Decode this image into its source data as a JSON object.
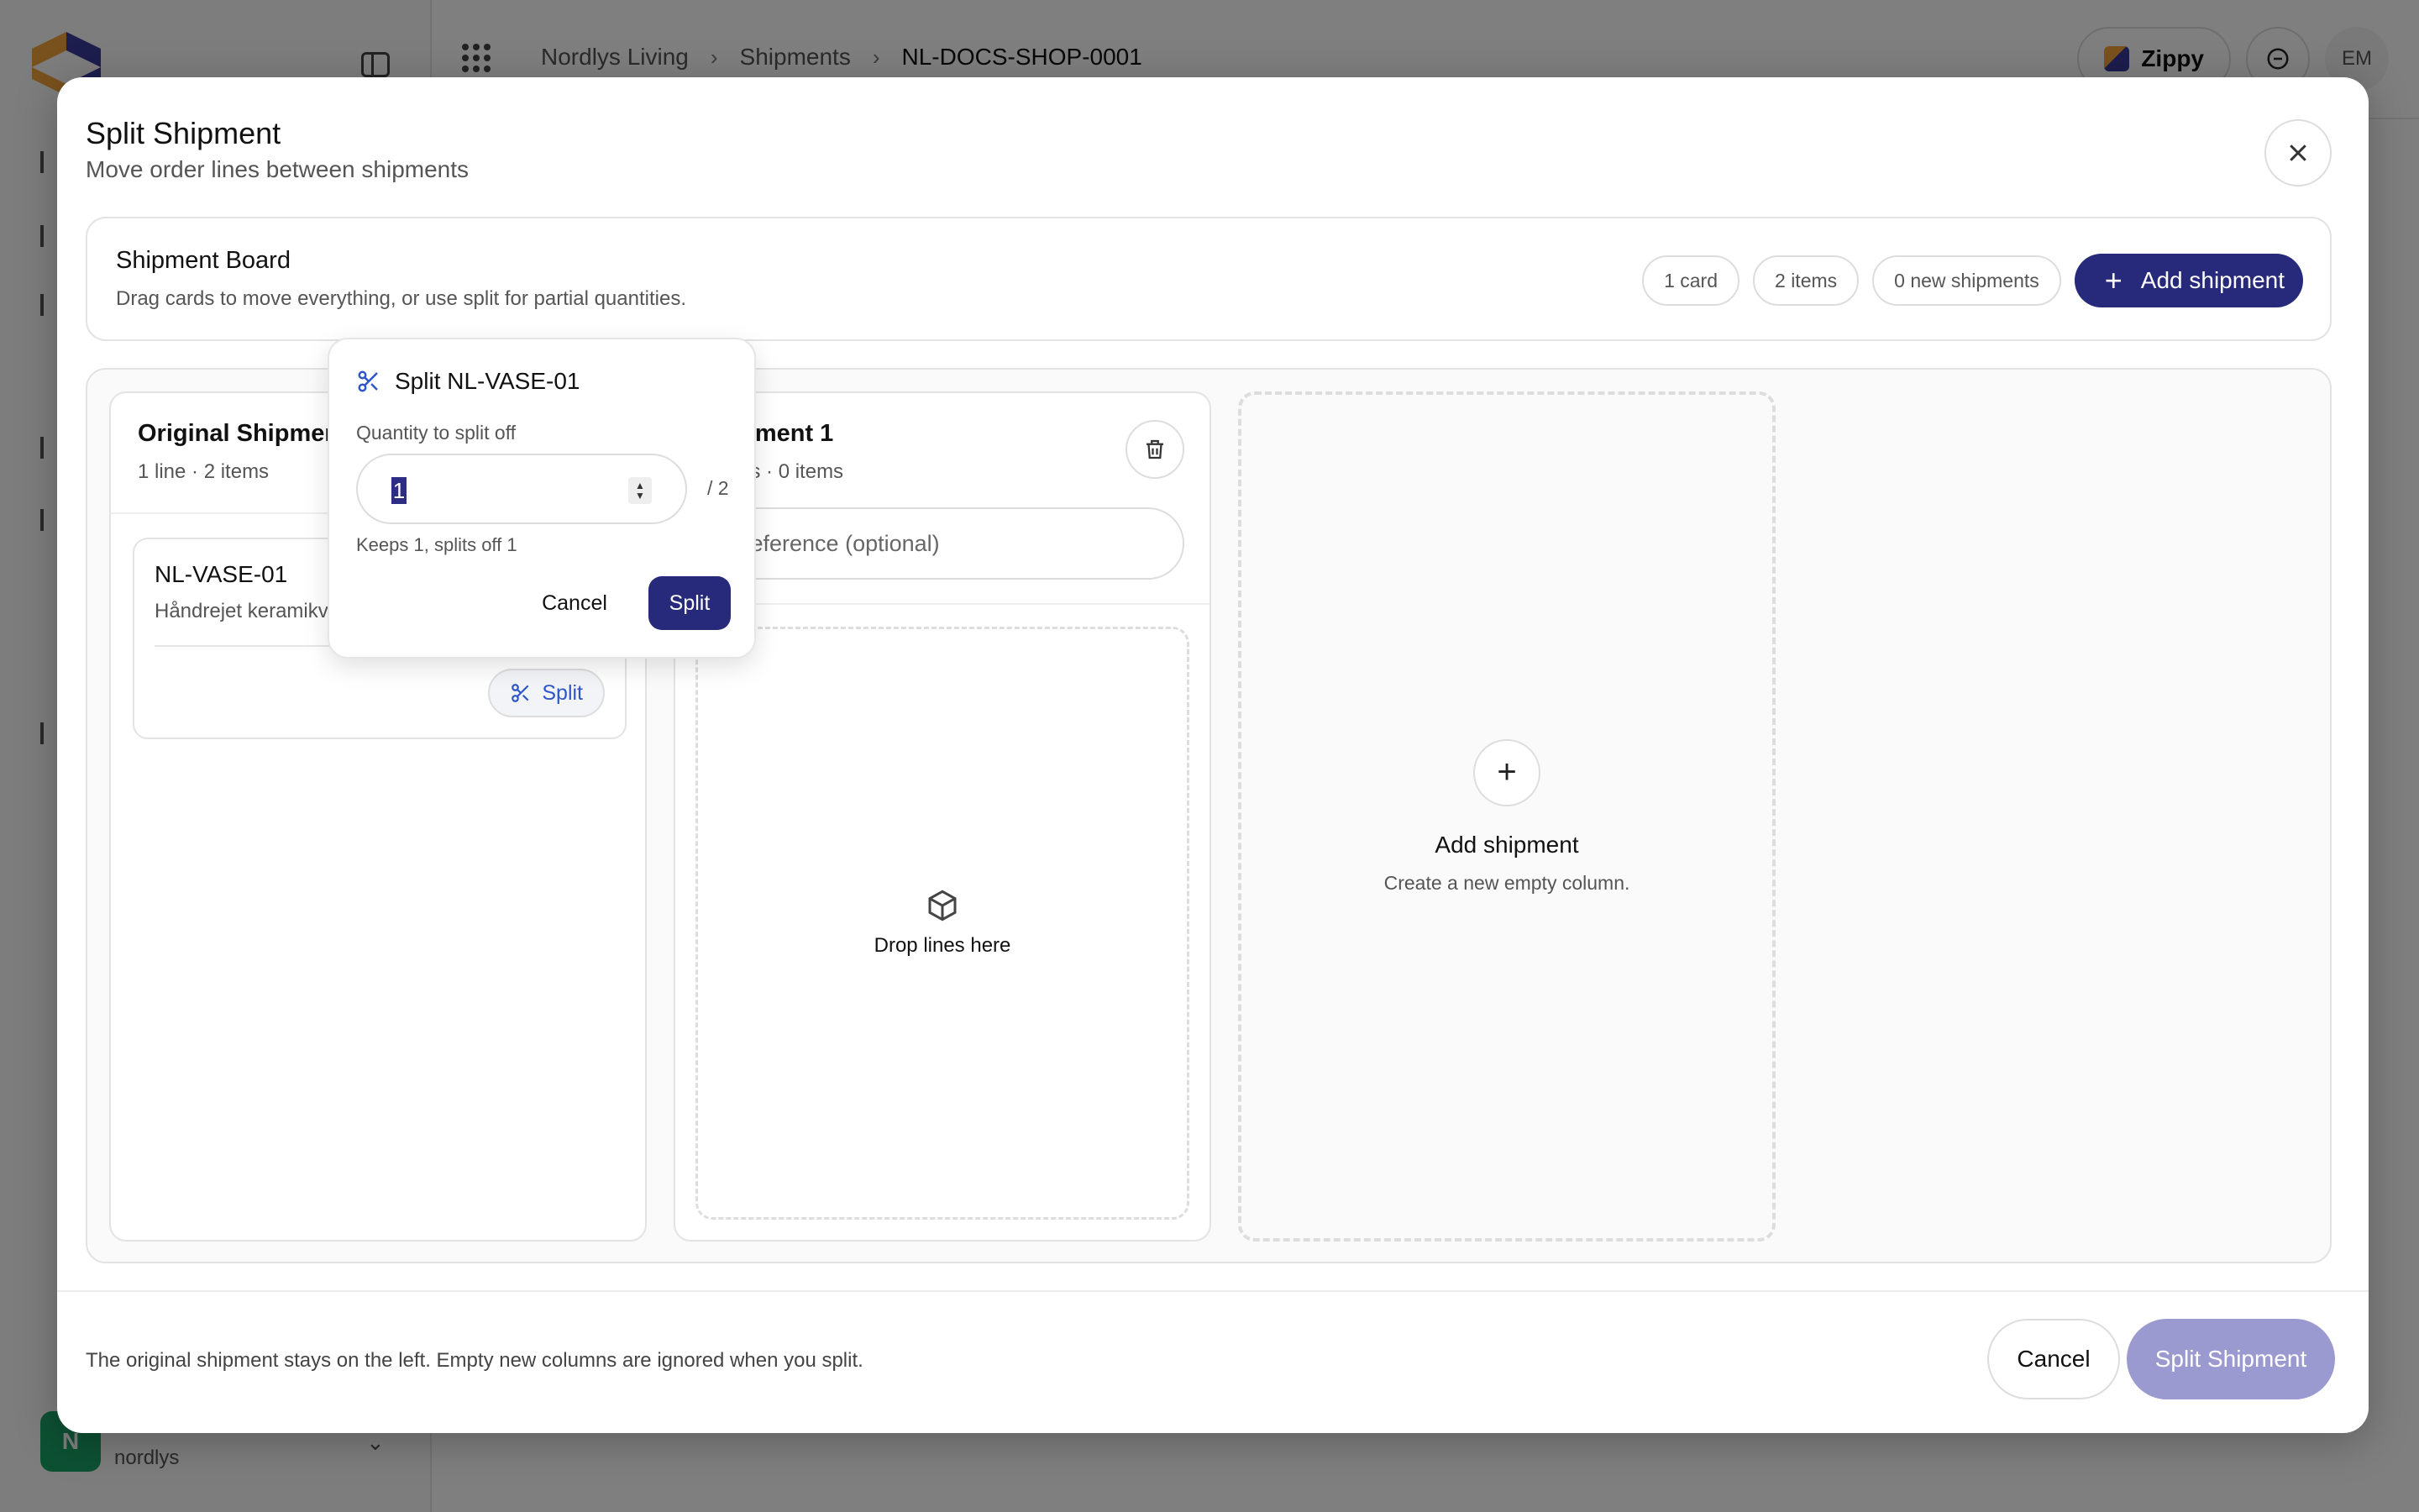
{
  "app": {
    "breadcrumbs": [
      "Nordlys Living",
      "Shipments",
      "NL-DOCS-SHOP-0001"
    ],
    "top_right": {
      "brand_label": "Zippy",
      "user_initials": "EM"
    },
    "sidebar": {
      "user_initial": "N",
      "user_workspace": "nordlys"
    }
  },
  "modal": {
    "title": "Split Shipment",
    "subtitle": "Move order lines between shipments",
    "board": {
      "title": "Shipment Board",
      "subtitle": "Drag cards to move everything, or use split for partial quantities.",
      "pills": [
        "1 card",
        "2 items",
        "0 new shipments"
      ],
      "add_button": "Add shipment"
    },
    "columns": {
      "original": {
        "title": "Original Shipment",
        "meta": "1 line · 2 items",
        "card": {
          "sku": "NL-VASE-01",
          "name": "Håndrejet keramikvase",
          "split_label": "Split"
        }
      },
      "shipment1": {
        "title": "Shipment 1",
        "meta": "0 lines · 0 items",
        "reference_placeholder": "Reference (optional)",
        "drop_text": "Drop lines here"
      },
      "add": {
        "title": "Add shipment",
        "subtitle": "Create a new empty column."
      }
    },
    "footer": {
      "note": "The original shipment stays on the left. Empty new columns are ignored when you split.",
      "cancel": "Cancel",
      "submit": "Split Shipment"
    }
  },
  "popover": {
    "title": "Split NL-VASE-01",
    "label": "Quantity to split off",
    "quantity": "1",
    "of": "/ 2",
    "hint": "Keeps 1, splits off 1",
    "cancel": "Cancel",
    "submit": "Split"
  },
  "colors": {
    "accent": "#27297a",
    "link": "#2e56c6",
    "disabled": "#9b9ad0"
  }
}
